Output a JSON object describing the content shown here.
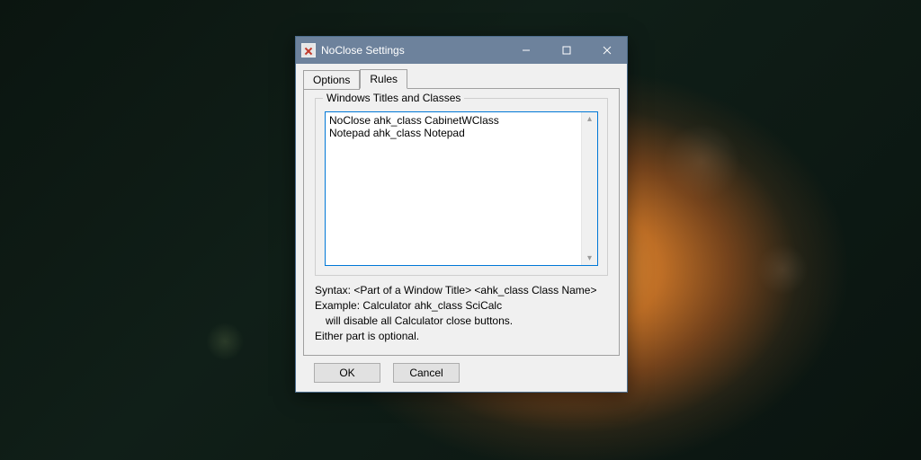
{
  "window": {
    "title": "NoClose Settings"
  },
  "tabs": {
    "options": "Options",
    "rules": "Rules"
  },
  "group": {
    "legend": "Windows Titles and Classes",
    "textarea_value": "NoClose ahk_class CabinetWClass\nNotepad ahk_class Notepad"
  },
  "help": {
    "syntax": "Syntax: <Part of a Window Title> <ahk_class Class Name>",
    "example": "Example: Calculator ahk_class SciCalc",
    "example_note": "will disable all Calculator close buttons.",
    "optional": "Either part is optional."
  },
  "buttons": {
    "ok": "OK",
    "cancel": "Cancel"
  }
}
